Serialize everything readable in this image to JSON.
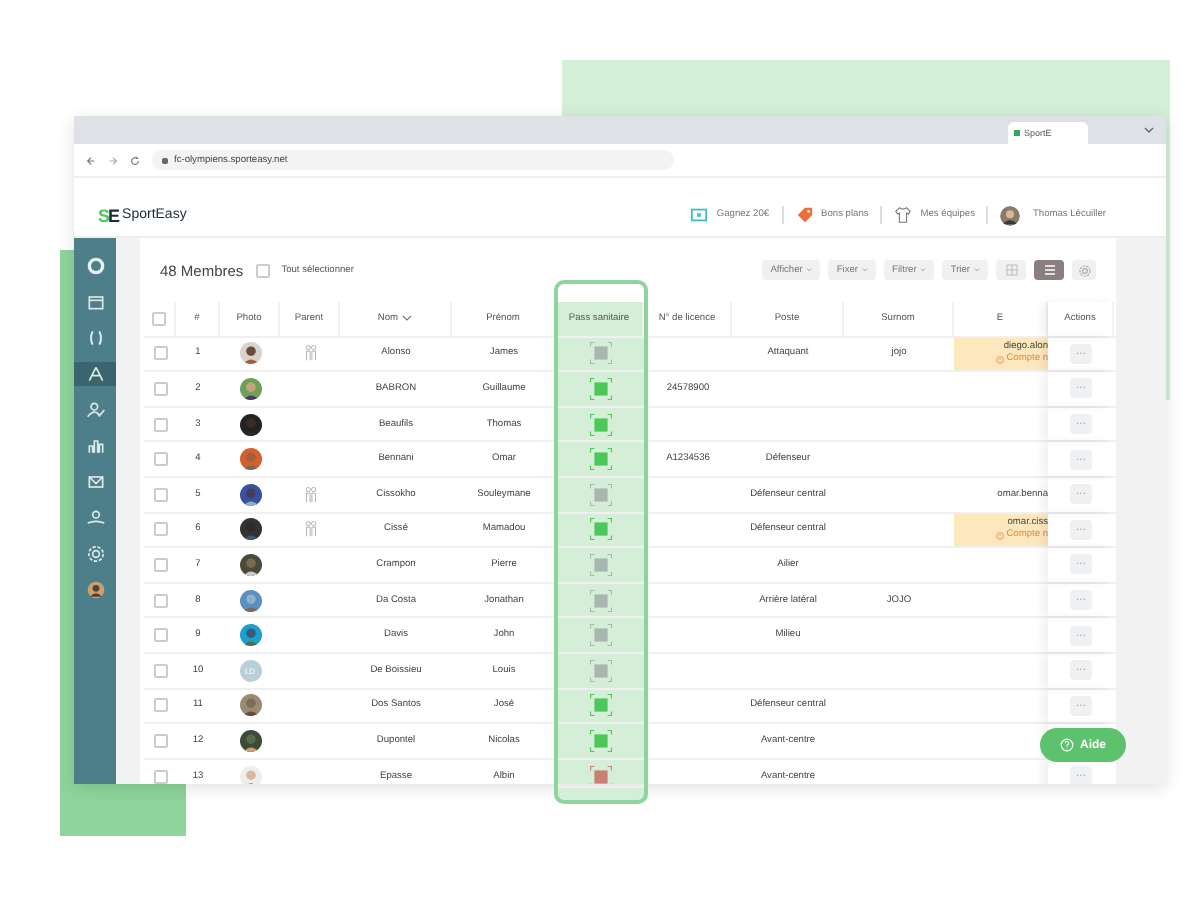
{
  "browser": {
    "tab_title": "SportE",
    "url": "fc-olympiens.sporteasy.net"
  },
  "header": {
    "logo_mark": "SE",
    "logo_text": "SportEasy",
    "links": [
      {
        "label": "Gagnez 20€"
      },
      {
        "label": "Bons plans"
      },
      {
        "label": "Mes équipes"
      }
    ],
    "user": "Thomas Lécuiller"
  },
  "sidebar": {
    "items": [
      {
        "selected": false
      },
      {
        "selected": false
      },
      {
        "selected": false
      },
      {
        "selected": true
      },
      {
        "selected": false
      },
      {
        "selected": false
      },
      {
        "selected": false
      },
      {
        "selected": false
      },
      {
        "selected": false
      },
      {
        "selected": false
      }
    ]
  },
  "toolbar": {
    "count": "48 Membres",
    "select_all": {
      "label": "Tout sélectionner",
      "checked": false
    },
    "buttons": [
      {
        "label": "Afficher"
      },
      {
        "label": "Fixer"
      },
      {
        "label": "Filtrer"
      },
      {
        "label": "Trier"
      }
    ],
    "views": [
      {
        "selected": false
      },
      {
        "selected": true
      }
    ]
  },
  "table": {
    "header_checkbox": {
      "checked": false
    },
    "columns": [
      {
        "label": "#",
        "sorted": false
      },
      {
        "label": "Photo",
        "sorted": false
      },
      {
        "label": "Parent",
        "sorted": false
      },
      {
        "label": "Nom",
        "sorted": true
      },
      {
        "label": "Prénom",
        "sorted": false
      },
      {
        "label": "Pass sanitaire",
        "sorted": false
      },
      {
        "label": "N° de licence",
        "sorted": false
      },
      {
        "label": "Poste",
        "sorted": false
      },
      {
        "label": "Surnom",
        "sorted": false
      },
      {
        "label": "E",
        "sorted": false
      },
      {
        "label": "Actions",
        "sorted": false
      }
    ],
    "rows": [
      {
        "checked": false,
        "num": "1",
        "parent": true,
        "nom": "Alonso",
        "prenom": "James",
        "pass": {
          "color": "#a9b5b0"
        },
        "poste": "Attaquant",
        "surnom": "jojo",
        "email": "diego.alon",
        "warning": "Compte n",
        "menu": "···"
      },
      {
        "checked": false,
        "num": "2",
        "parent": false,
        "nom": "BABRON",
        "prenom": "Guillaume",
        "pass": {
          "color": "#4cc85a"
        },
        "licence": "24578900",
        "menu": "···"
      },
      {
        "checked": false,
        "num": "3",
        "parent": false,
        "nom": "Beaufils",
        "prenom": "Thomas",
        "pass": {
          "color": "#4cc85a"
        },
        "menu": "···"
      },
      {
        "checked": false,
        "num": "4",
        "parent": false,
        "nom": "Bennani",
        "prenom": "Omar",
        "pass": {
          "color": "#4cc85a"
        },
        "licence": "A1234536",
        "poste": "Défenseur",
        "menu": "···"
      },
      {
        "checked": false,
        "num": "5",
        "parent": true,
        "nom": "Cissokho",
        "prenom": "Souleymane",
        "pass": {
          "color": "#a9b5b0"
        },
        "poste": "Défenseur central",
        "email": "omar.benna",
        "menu": "···"
      },
      {
        "checked": false,
        "num": "6",
        "parent": true,
        "nom": "Cissé",
        "prenom": "Mamadou",
        "pass": {
          "color": "#4cc85a"
        },
        "poste": "Défenseur central",
        "email": "omar.ciss",
        "warning": "Compte n",
        "menu": "···"
      },
      {
        "checked": false,
        "num": "7",
        "parent": false,
        "nom": "Crampon",
        "prenom": "Pierre",
        "pass": {
          "color": "#a9b5b0"
        },
        "poste": "Ailier",
        "menu": "···"
      },
      {
        "checked": false,
        "num": "8",
        "parent": false,
        "nom": "Da Costa",
        "prenom": "Jonathan",
        "pass": {
          "color": "#a9b5b0"
        },
        "poste": "Arrière latéral",
        "surnom": "JOJO",
        "menu": "···"
      },
      {
        "checked": false,
        "num": "9",
        "parent": false,
        "nom": "Davis",
        "prenom": "John",
        "pass": {
          "color": "#a9b5b0"
        },
        "poste": "Milieu",
        "menu": "···"
      },
      {
        "checked": false,
        "num": "10",
        "initials": "LD",
        "parent": false,
        "nom": "De Boissieu",
        "prenom": "Louis",
        "pass": {
          "color": "#a9b5b0"
        },
        "menu": "···"
      },
      {
        "checked": false,
        "num": "11",
        "parent": false,
        "nom": "Dos Santos",
        "prenom": "José",
        "pass": {
          "color": "#4cc85a"
        },
        "poste": "Défenseur central",
        "menu": "···"
      },
      {
        "checked": false,
        "num": "12",
        "parent": false,
        "nom": "Dupontel",
        "prenom": "Nicolas",
        "pass": {
          "color": "#4cc85a"
        },
        "poste": "Avant-centre"
      },
      {
        "checked": false,
        "num": "13",
        "parent": false,
        "nom": "Epasse",
        "prenom": "Albin",
        "pass": {
          "color": "#c9806e"
        },
        "poste": "Avant-centre",
        "menu": "···"
      }
    ]
  },
  "help": {
    "label": "Aide"
  }
}
